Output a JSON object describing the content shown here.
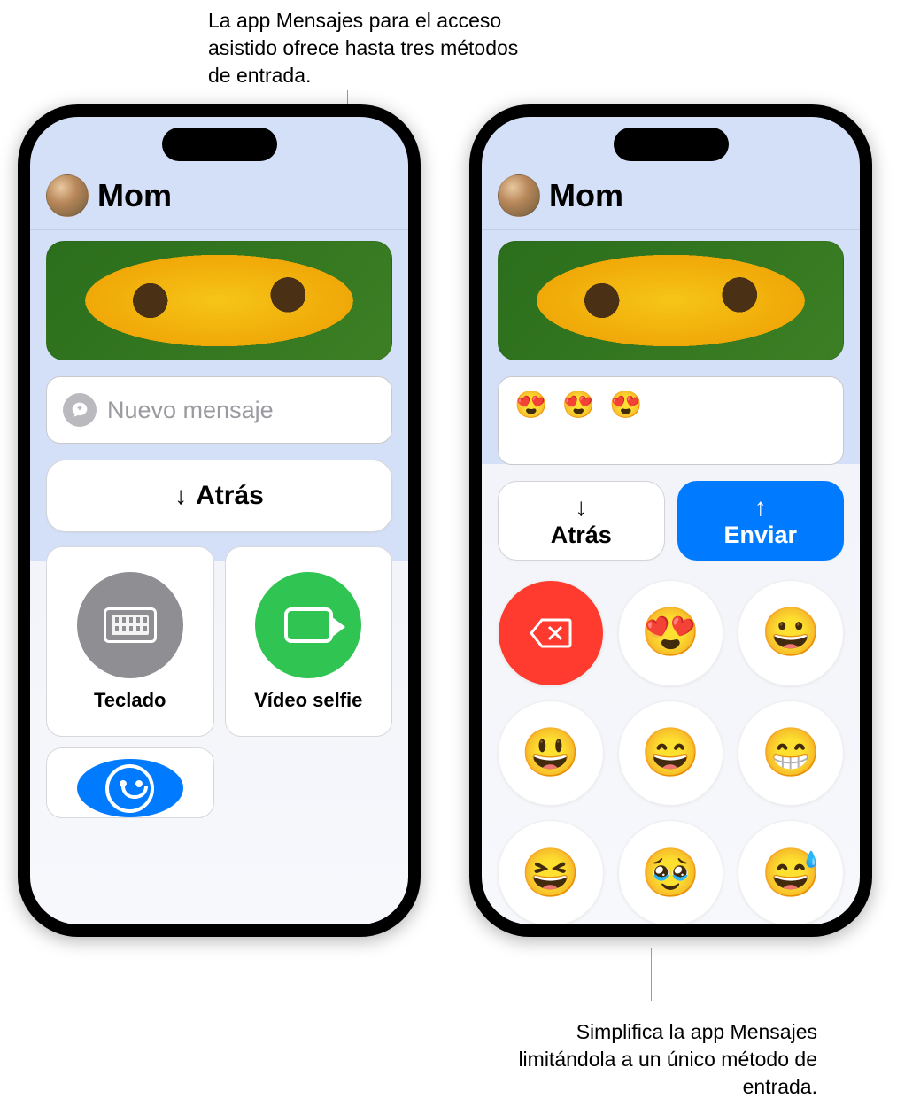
{
  "captions": {
    "top": "La app Mensajes para el acceso asistido ofrece hasta tres métodos de entrada.",
    "bottom": "Simplifica la app Mensajes limitándola a un único método de entrada."
  },
  "phone_left": {
    "contact_name": "Mom",
    "compose_placeholder": "Nuevo mensaje",
    "back_label": "Atrás",
    "cards": {
      "keyboard": "Teclado",
      "video": "Vídeo selfie"
    }
  },
  "phone_right": {
    "contact_name": "Mom",
    "compose_value": "😍 😍 😍",
    "back_label": "Atrás",
    "send_label": "Enviar",
    "emoji_keys": [
      "😍",
      "😀",
      "😃",
      "😄",
      "😁",
      "😆",
      "🥹",
      "😅"
    ]
  }
}
